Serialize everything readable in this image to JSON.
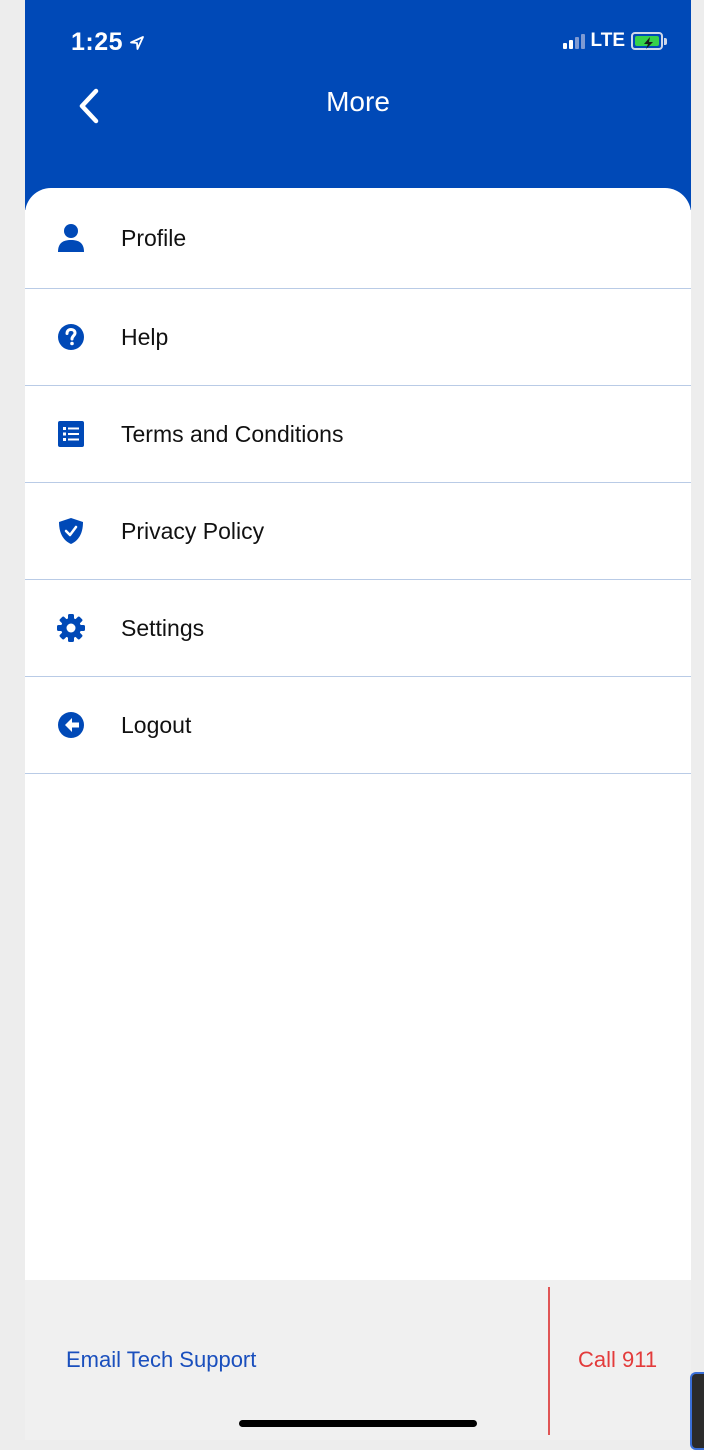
{
  "status_bar": {
    "time": "1:25",
    "network": "LTE"
  },
  "header": {
    "title": "More",
    "back_icon": "chevron-left-icon"
  },
  "menu": {
    "items": [
      {
        "label": "Profile",
        "icon": "person-icon"
      },
      {
        "label": "Help",
        "icon": "question-circle-icon"
      },
      {
        "label": "Terms and Conditions",
        "icon": "list-icon"
      },
      {
        "label": "Privacy Policy",
        "icon": "shield-check-icon"
      },
      {
        "label": "Settings",
        "icon": "gear-icon"
      },
      {
        "label": "Logout",
        "icon": "logout-arrow-icon"
      }
    ]
  },
  "footer": {
    "email_support": "Email Tech Support",
    "call_911": "Call 911"
  },
  "colors": {
    "brand_blue": "#0049b7",
    "emergency_red": "#e33b3b",
    "divider_blue": "#b9cbe6"
  }
}
